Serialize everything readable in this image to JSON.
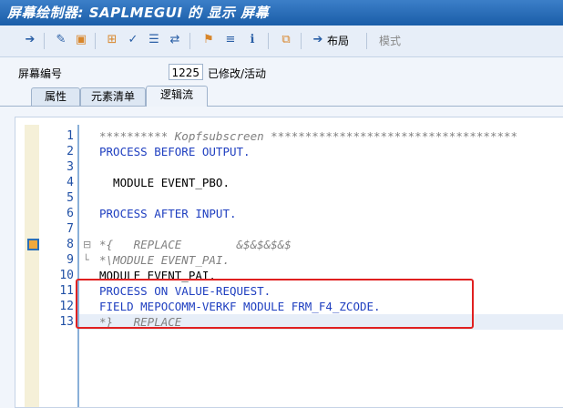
{
  "window": {
    "title": "屏幕绘制器: SAPLMEGUI 的 显示 屏幕"
  },
  "toolbar": {
    "layout_label": "布局",
    "mode_label": "模式"
  },
  "screen": {
    "label": "屏幕编号",
    "number": "1225",
    "status": "已修改/活动"
  },
  "tabs": [
    {
      "label": "属性"
    },
    {
      "label": "元素清单"
    },
    {
      "label": "逻辑流"
    }
  ],
  "editor": {
    "line_numbers": [
      "1",
      "2",
      "3",
      "4",
      "5",
      "6",
      "7",
      "8",
      "9",
      "10",
      "11",
      "12",
      "13"
    ],
    "lines": [
      {
        "text": "********** Kopfsubscreen ************************************"
      },
      {
        "text": "PROCESS BEFORE OUTPUT."
      },
      {
        "text": ""
      },
      {
        "text": "  MODULE EVENT_PBO."
      },
      {
        "text": ""
      },
      {
        "text": "PROCESS AFTER INPUT."
      },
      {
        "text": ""
      },
      {
        "text": "*{   REPLACE        &$&$&$&$"
      },
      {
        "text": "*\\MODULE EVENT_PAI."
      },
      {
        "text": "MODULE EVENT_PAI."
      },
      {
        "text": "PROCESS ON VALUE-REQUEST."
      },
      {
        "text": "FIELD MEPOCOMM-VERKF MODULE FRM_F4_ZCODE."
      },
      {
        "text": "*}   REPLACE"
      }
    ]
  }
}
